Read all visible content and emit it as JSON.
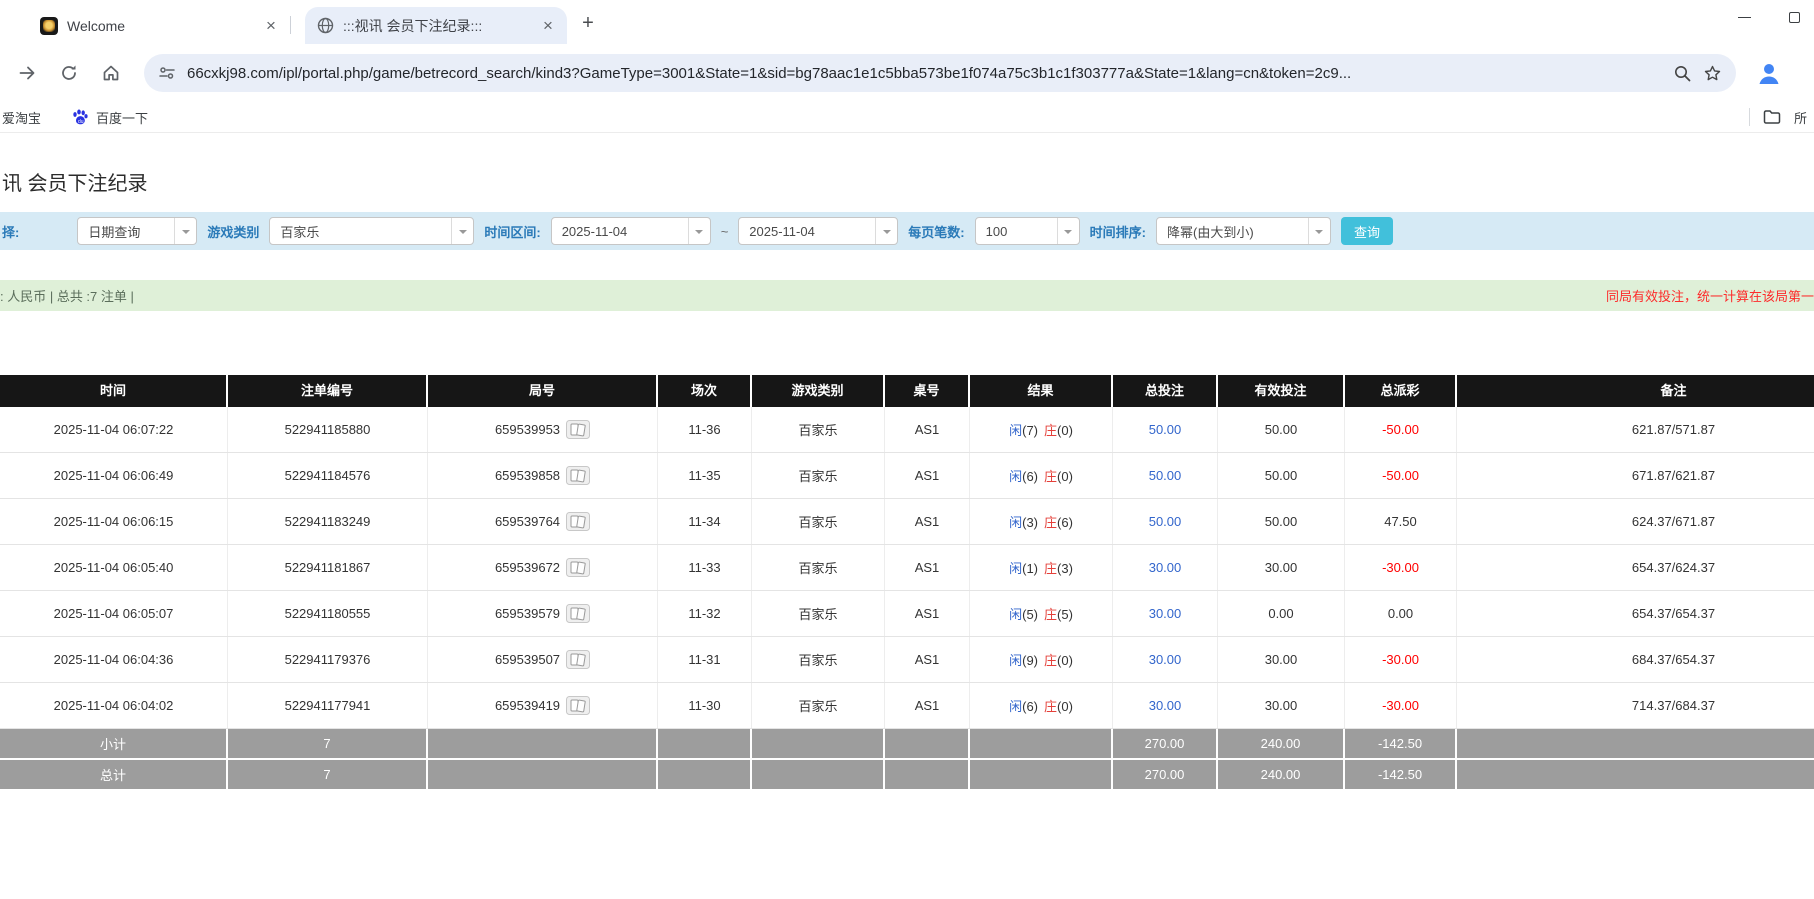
{
  "browser": {
    "tabs": [
      {
        "title": "Welcome"
      },
      {
        "title": ":::视讯 会员下注纪录:::"
      }
    ],
    "url": "66cxkj98.com/ipl/portal.php/game/betrecord_search/kind3?GameType=3001&State=1&sid=bg78aac1e1c5bba573be1f074a75c3b1c1f303777a&State=1&lang=cn&token=2c9...",
    "bookmarks": [
      "爱淘宝",
      "百度一下"
    ],
    "bookmarks_folder": "所"
  },
  "icons": {
    "tab_close": "close-icon",
    "new_tab": "plus-icon",
    "nav": [
      "forward-icon",
      "reload-icon",
      "home-icon"
    ],
    "urlbar": [
      "site-settings-icon",
      "zoom-icon",
      "star-icon"
    ],
    "profile": "person-avatar-icon",
    "bookmark_engine": "baidu-paw-icon",
    "round_cell": "cards-icon"
  },
  "colors": {
    "accent_button": "#41c0db",
    "filter_bar_bg": "#d6eaf5",
    "info_bar_bg": "#dff0d8",
    "table_header_bg": "#161616",
    "table_footer_bg": "#9d9d9d",
    "negative_red": "#ff0000",
    "link_blue": "#3366cc",
    "banker_red": "#e4403a"
  },
  "page": {
    "title": "讯 会员下注纪录",
    "filter": {
      "select_label": "择:",
      "date_mode": "日期查询",
      "game_type_label": "游戏类别",
      "game_type": "百家乐",
      "range_label": "时间区间:",
      "date_from": "2025-11-04",
      "range_tilde": "~",
      "date_to": "2025-11-04",
      "page_size_label": "每页笔数:",
      "page_size": "100",
      "sort_label": "时间排序:",
      "sort": "降幂(由大到小)",
      "search_button": "查询"
    },
    "infobar": {
      "left": ": 人民币 | 总共 :7 注单 |",
      "right": "同局有效投注，统一计算在该局第一张注"
    },
    "table": {
      "columns": [
        "时间",
        "注单编号",
        "局号",
        "场次",
        "游戏类别",
        "桌号",
        "结果",
        "总投注",
        "有效投注",
        "总派彩",
        "备注"
      ],
      "rows": [
        {
          "time": "2025-11-04 06:07:22",
          "bet_id": "522941185880",
          "round": "659539953",
          "session": "11-36",
          "game": "百家乐",
          "table": "AS1",
          "result": {
            "player_label": "闲",
            "player_value": "(7)",
            "banker_label": "庄",
            "banker_value": "(0)"
          },
          "total_bet": "50.00",
          "valid_bet": "50.00",
          "payout": "-50.00",
          "remark": "621.87/571.87"
        },
        {
          "time": "2025-11-04 06:06:49",
          "bet_id": "522941184576",
          "round": "659539858",
          "session": "11-35",
          "game": "百家乐",
          "table": "AS1",
          "result": {
            "player_label": "闲",
            "player_value": "(6)",
            "banker_label": "庄",
            "banker_value": "(0)"
          },
          "total_bet": "50.00",
          "valid_bet": "50.00",
          "payout": "-50.00",
          "remark": "671.87/621.87"
        },
        {
          "time": "2025-11-04 06:06:15",
          "bet_id": "522941183249",
          "round": "659539764",
          "session": "11-34",
          "game": "百家乐",
          "table": "AS1",
          "result": {
            "player_label": "闲",
            "player_value": "(3)",
            "banker_label": "庄",
            "banker_value": "(6)"
          },
          "total_bet": "50.00",
          "valid_bet": "50.00",
          "payout": "47.50",
          "remark": "624.37/671.87"
        },
        {
          "time": "2025-11-04 06:05:40",
          "bet_id": "522941181867",
          "round": "659539672",
          "session": "11-33",
          "game": "百家乐",
          "table": "AS1",
          "result": {
            "player_label": "闲",
            "player_value": "(1)",
            "banker_label": "庄",
            "banker_value": "(3)"
          },
          "total_bet": "30.00",
          "valid_bet": "30.00",
          "payout": "-30.00",
          "remark": "654.37/624.37"
        },
        {
          "time": "2025-11-04 06:05:07",
          "bet_id": "522941180555",
          "round": "659539579",
          "session": "11-32",
          "game": "百家乐",
          "table": "AS1",
          "result": {
            "player_label": "闲",
            "player_value": "(5)",
            "banker_label": "庄",
            "banker_value": "(5)"
          },
          "total_bet": "30.00",
          "valid_bet": "0.00",
          "payout": "0.00",
          "remark": "654.37/654.37"
        },
        {
          "time": "2025-11-04 06:04:36",
          "bet_id": "522941179376",
          "round": "659539507",
          "session": "11-31",
          "game": "百家乐",
          "table": "AS1",
          "result": {
            "player_label": "闲",
            "player_value": "(9)",
            "banker_label": "庄",
            "banker_value": "(0)"
          },
          "total_bet": "30.00",
          "valid_bet": "30.00",
          "payout": "-30.00",
          "remark": "684.37/654.37"
        },
        {
          "time": "2025-11-04 06:04:02",
          "bet_id": "522941177941",
          "round": "659539419",
          "session": "11-30",
          "game": "百家乐",
          "table": "AS1",
          "result": {
            "player_label": "闲",
            "player_value": "(6)",
            "banker_label": "庄",
            "banker_value": "(0)"
          },
          "total_bet": "30.00",
          "valid_bet": "30.00",
          "payout": "-30.00",
          "remark": "714.37/684.37"
        }
      ],
      "footer": [
        {
          "label": "小计",
          "count": "7",
          "total_bet": "270.00",
          "valid_bet": "240.00",
          "payout": "-142.50"
        },
        {
          "label": "总计",
          "count": "7",
          "total_bet": "270.00",
          "valid_bet": "240.00",
          "payout": "-142.50"
        }
      ]
    }
  }
}
